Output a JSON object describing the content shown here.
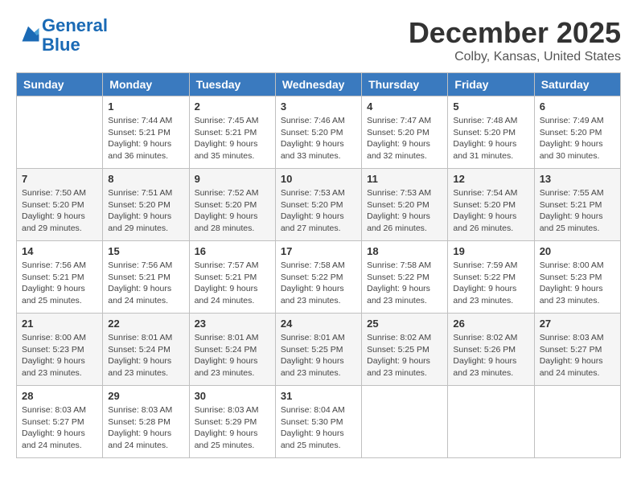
{
  "logo": {
    "line1": "General",
    "line2": "Blue"
  },
  "title": "December 2025",
  "location": "Colby, Kansas, United States",
  "days_header": [
    "Sunday",
    "Monday",
    "Tuesday",
    "Wednesday",
    "Thursday",
    "Friday",
    "Saturday"
  ],
  "weeks": [
    [
      {
        "day": "",
        "sunrise": "",
        "sunset": "",
        "daylight": ""
      },
      {
        "day": "1",
        "sunrise": "Sunrise: 7:44 AM",
        "sunset": "Sunset: 5:21 PM",
        "daylight": "Daylight: 9 hours and 36 minutes."
      },
      {
        "day": "2",
        "sunrise": "Sunrise: 7:45 AM",
        "sunset": "Sunset: 5:21 PM",
        "daylight": "Daylight: 9 hours and 35 minutes."
      },
      {
        "day": "3",
        "sunrise": "Sunrise: 7:46 AM",
        "sunset": "Sunset: 5:20 PM",
        "daylight": "Daylight: 9 hours and 33 minutes."
      },
      {
        "day": "4",
        "sunrise": "Sunrise: 7:47 AM",
        "sunset": "Sunset: 5:20 PM",
        "daylight": "Daylight: 9 hours and 32 minutes."
      },
      {
        "day": "5",
        "sunrise": "Sunrise: 7:48 AM",
        "sunset": "Sunset: 5:20 PM",
        "daylight": "Daylight: 9 hours and 31 minutes."
      },
      {
        "day": "6",
        "sunrise": "Sunrise: 7:49 AM",
        "sunset": "Sunset: 5:20 PM",
        "daylight": "Daylight: 9 hours and 30 minutes."
      }
    ],
    [
      {
        "day": "7",
        "sunrise": "Sunrise: 7:50 AM",
        "sunset": "Sunset: 5:20 PM",
        "daylight": "Daylight: 9 hours and 29 minutes."
      },
      {
        "day": "8",
        "sunrise": "Sunrise: 7:51 AM",
        "sunset": "Sunset: 5:20 PM",
        "daylight": "Daylight: 9 hours and 29 minutes."
      },
      {
        "day": "9",
        "sunrise": "Sunrise: 7:52 AM",
        "sunset": "Sunset: 5:20 PM",
        "daylight": "Daylight: 9 hours and 28 minutes."
      },
      {
        "day": "10",
        "sunrise": "Sunrise: 7:53 AM",
        "sunset": "Sunset: 5:20 PM",
        "daylight": "Daylight: 9 hours and 27 minutes."
      },
      {
        "day": "11",
        "sunrise": "Sunrise: 7:53 AM",
        "sunset": "Sunset: 5:20 PM",
        "daylight": "Daylight: 9 hours and 26 minutes."
      },
      {
        "day": "12",
        "sunrise": "Sunrise: 7:54 AM",
        "sunset": "Sunset: 5:20 PM",
        "daylight": "Daylight: 9 hours and 26 minutes."
      },
      {
        "day": "13",
        "sunrise": "Sunrise: 7:55 AM",
        "sunset": "Sunset: 5:21 PM",
        "daylight": "Daylight: 9 hours and 25 minutes."
      }
    ],
    [
      {
        "day": "14",
        "sunrise": "Sunrise: 7:56 AM",
        "sunset": "Sunset: 5:21 PM",
        "daylight": "Daylight: 9 hours and 25 minutes."
      },
      {
        "day": "15",
        "sunrise": "Sunrise: 7:56 AM",
        "sunset": "Sunset: 5:21 PM",
        "daylight": "Daylight: 9 hours and 24 minutes."
      },
      {
        "day": "16",
        "sunrise": "Sunrise: 7:57 AM",
        "sunset": "Sunset: 5:21 PM",
        "daylight": "Daylight: 9 hours and 24 minutes."
      },
      {
        "day": "17",
        "sunrise": "Sunrise: 7:58 AM",
        "sunset": "Sunset: 5:22 PM",
        "daylight": "Daylight: 9 hours and 23 minutes."
      },
      {
        "day": "18",
        "sunrise": "Sunrise: 7:58 AM",
        "sunset": "Sunset: 5:22 PM",
        "daylight": "Daylight: 9 hours and 23 minutes."
      },
      {
        "day": "19",
        "sunrise": "Sunrise: 7:59 AM",
        "sunset": "Sunset: 5:22 PM",
        "daylight": "Daylight: 9 hours and 23 minutes."
      },
      {
        "day": "20",
        "sunrise": "Sunrise: 8:00 AM",
        "sunset": "Sunset: 5:23 PM",
        "daylight": "Daylight: 9 hours and 23 minutes."
      }
    ],
    [
      {
        "day": "21",
        "sunrise": "Sunrise: 8:00 AM",
        "sunset": "Sunset: 5:23 PM",
        "daylight": "Daylight: 9 hours and 23 minutes."
      },
      {
        "day": "22",
        "sunrise": "Sunrise: 8:01 AM",
        "sunset": "Sunset: 5:24 PM",
        "daylight": "Daylight: 9 hours and 23 minutes."
      },
      {
        "day": "23",
        "sunrise": "Sunrise: 8:01 AM",
        "sunset": "Sunset: 5:24 PM",
        "daylight": "Daylight: 9 hours and 23 minutes."
      },
      {
        "day": "24",
        "sunrise": "Sunrise: 8:01 AM",
        "sunset": "Sunset: 5:25 PM",
        "daylight": "Daylight: 9 hours and 23 minutes."
      },
      {
        "day": "25",
        "sunrise": "Sunrise: 8:02 AM",
        "sunset": "Sunset: 5:25 PM",
        "daylight": "Daylight: 9 hours and 23 minutes."
      },
      {
        "day": "26",
        "sunrise": "Sunrise: 8:02 AM",
        "sunset": "Sunset: 5:26 PM",
        "daylight": "Daylight: 9 hours and 23 minutes."
      },
      {
        "day": "27",
        "sunrise": "Sunrise: 8:03 AM",
        "sunset": "Sunset: 5:27 PM",
        "daylight": "Daylight: 9 hours and 24 minutes."
      }
    ],
    [
      {
        "day": "28",
        "sunrise": "Sunrise: 8:03 AM",
        "sunset": "Sunset: 5:27 PM",
        "daylight": "Daylight: 9 hours and 24 minutes."
      },
      {
        "day": "29",
        "sunrise": "Sunrise: 8:03 AM",
        "sunset": "Sunset: 5:28 PM",
        "daylight": "Daylight: 9 hours and 24 minutes."
      },
      {
        "day": "30",
        "sunrise": "Sunrise: 8:03 AM",
        "sunset": "Sunset: 5:29 PM",
        "daylight": "Daylight: 9 hours and 25 minutes."
      },
      {
        "day": "31",
        "sunrise": "Sunrise: 8:04 AM",
        "sunset": "Sunset: 5:30 PM",
        "daylight": "Daylight: 9 hours and 25 minutes."
      },
      {
        "day": "",
        "sunrise": "",
        "sunset": "",
        "daylight": ""
      },
      {
        "day": "",
        "sunrise": "",
        "sunset": "",
        "daylight": ""
      },
      {
        "day": "",
        "sunrise": "",
        "sunset": "",
        "daylight": ""
      }
    ]
  ]
}
